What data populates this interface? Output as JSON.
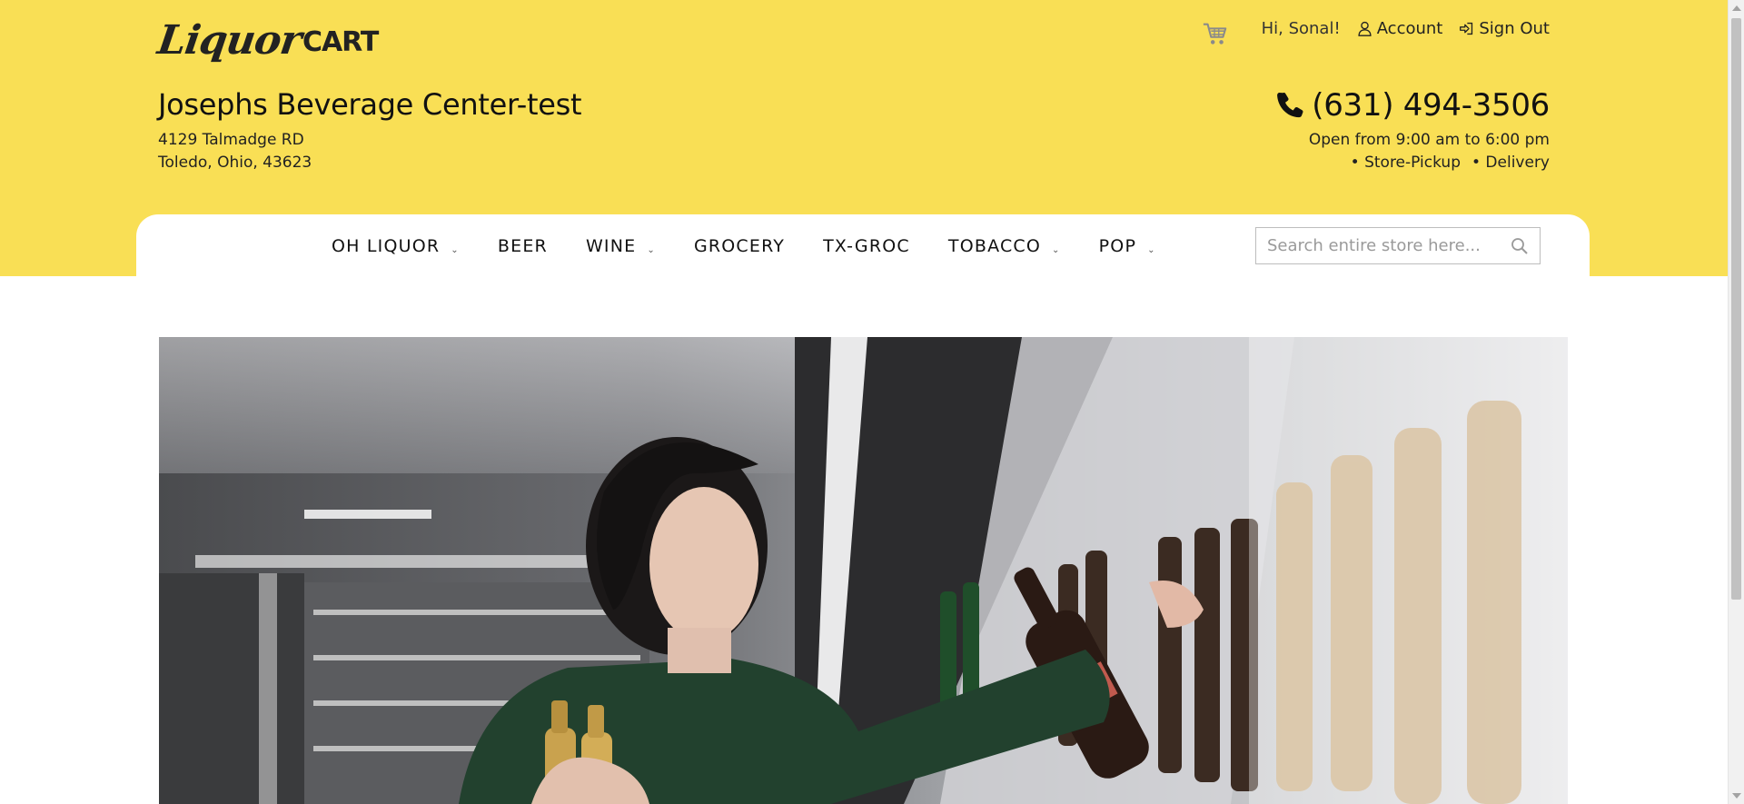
{
  "brand": {
    "logo_script": "Liquor",
    "logo_bold": "CART"
  },
  "utility": {
    "greeting": "Hi, Sonal!",
    "account_label": "Account",
    "signout_label": "Sign Out"
  },
  "store": {
    "name": "Josephs Beverage Center-test",
    "address_line1": "4129 Talmadge RD",
    "address_line2": "Toledo, Ohio, 43623",
    "phone": "(631) 494-3506",
    "hours": "Open from 9:00 am to 6:00 pm",
    "services": [
      "• Store-Pickup",
      "• Delivery"
    ]
  },
  "nav": {
    "items": [
      {
        "label": "OH LIQUOR",
        "has_dropdown": true
      },
      {
        "label": "BEER",
        "has_dropdown": false
      },
      {
        "label": "WINE",
        "has_dropdown": true
      },
      {
        "label": "GROCERY",
        "has_dropdown": false
      },
      {
        "label": "TX-GROC",
        "has_dropdown": false
      },
      {
        "label": "TOBACCO",
        "has_dropdown": true
      },
      {
        "label": "POP",
        "has_dropdown": true
      }
    ],
    "dropdown_glyph": "⌄"
  },
  "search": {
    "placeholder": "Search entire store here..."
  },
  "colors": {
    "brand_yellow": "#f9df55",
    "text": "#111111"
  },
  "icons": {
    "cart": "shopping-cart-icon",
    "account": "user-icon",
    "signout": "sign-out-icon",
    "phone": "phone-icon",
    "search": "search-icon"
  }
}
